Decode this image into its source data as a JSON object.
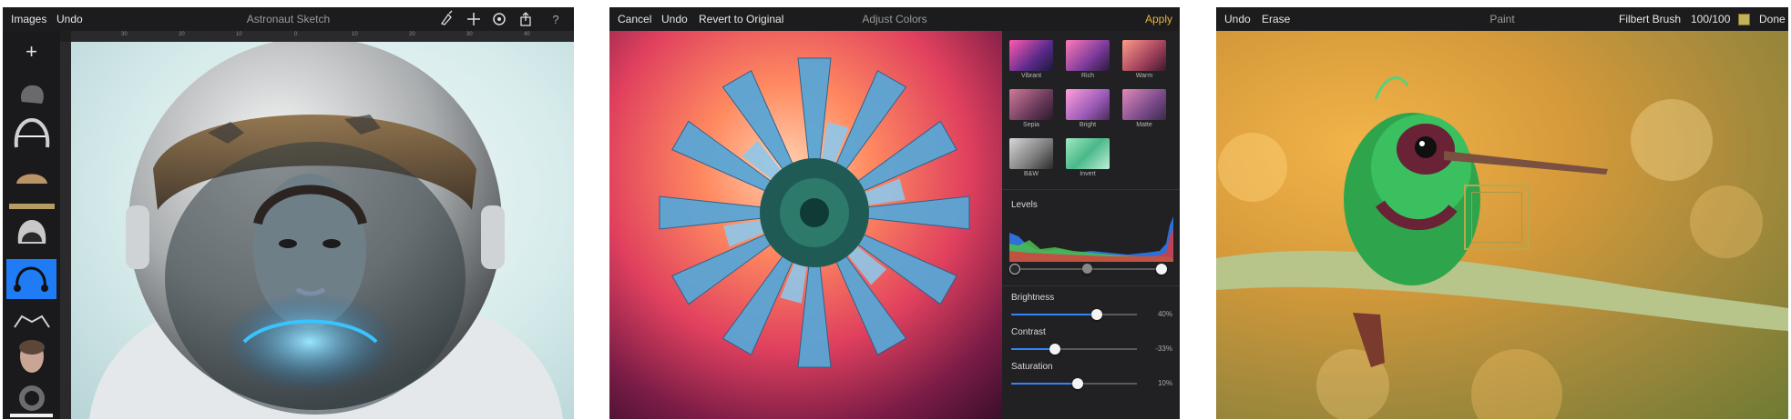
{
  "screen1": {
    "left_buttons": [
      "Images",
      "Undo"
    ],
    "title": "Astronaut Sketch",
    "toolbar_icons": [
      "brush-icon",
      "plus-icon",
      "gear-icon",
      "share-icon",
      "help-icon"
    ],
    "ruler_ticks": [
      "30",
      "20",
      "10",
      "0",
      "10",
      "20",
      "30",
      "40"
    ],
    "add_layer_symbol": "+"
  },
  "screen2": {
    "left_buttons": [
      "Cancel",
      "Undo",
      "Revert to Original"
    ],
    "title": "Adjust Colors",
    "apply_label": "Apply",
    "filters": [
      "Vibrant",
      "Rich",
      "Warm",
      "Sepia",
      "Bright",
      "Matte",
      "B&W",
      "Invert"
    ],
    "levels_label": "Levels",
    "sliders": [
      {
        "label": "Brightness",
        "value_text": "40%",
        "fraction": 0.68
      },
      {
        "label": "Contrast",
        "value_text": "-33%",
        "fraction": 0.35
      },
      {
        "label": "Saturation",
        "value_text": "10%",
        "fraction": 0.53
      }
    ]
  },
  "screen3": {
    "left_buttons": [
      "Undo",
      "Erase"
    ],
    "title": "Paint",
    "brush_name": "Filbert Brush",
    "brush_size": "100/100",
    "swatch_color": "#c2b25a",
    "done_label": "Done"
  },
  "colors": {
    "accent": "#e8b339",
    "slider_blue": "#2f86ff",
    "selected_layer": "#1f7cf5"
  }
}
